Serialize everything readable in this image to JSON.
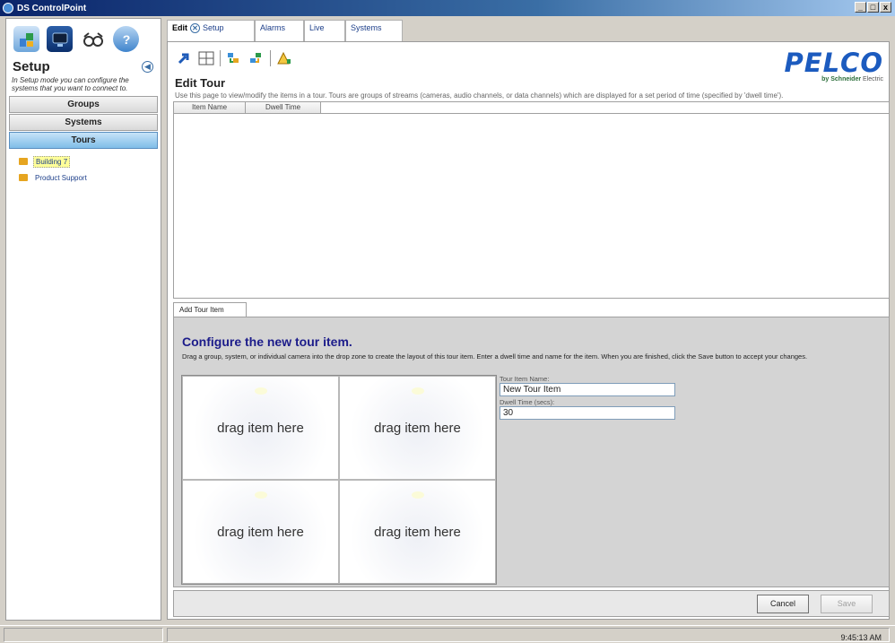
{
  "window": {
    "title": "DS ControlPoint",
    "min": "_",
    "max": "□",
    "close": "x"
  },
  "left": {
    "title": "Setup",
    "description": "In Setup mode you can configure the systems that you want to connect to.",
    "nav": [
      {
        "label": "Groups",
        "active": false
      },
      {
        "label": "Systems",
        "active": false
      },
      {
        "label": "Tours",
        "active": true
      }
    ],
    "tree": [
      {
        "label": "Building 7",
        "selected": true
      },
      {
        "label": "Product Support",
        "selected": false
      }
    ]
  },
  "tabs": {
    "edit": "Edit",
    "setup": "Setup",
    "alarms": "Alarms",
    "live": "Live",
    "systems": "Systems"
  },
  "logo": {
    "brand": "PELCO",
    "by": "by",
    "company": "Schneider",
    "company2": "Electric"
  },
  "page": {
    "title": "Edit Tour",
    "description": "Use this page to view/modify the items in a tour. Tours are groups of streams (cameras, audio channels, or data channels) which are displayed for a set period of time (specified by 'dwell time')."
  },
  "grid": {
    "columns": [
      "Item Name",
      "Dwell Time"
    ]
  },
  "subtab": "Add Tour Item",
  "config": {
    "title": "Configure the new tour item.",
    "description": "Drag a group, system, or individual camera into the drop zone to create the layout of this tour item. Enter a dwell time and name for the item. When you are finished, click the Save button to accept your changes.",
    "dropzones": [
      "drag item here",
      "drag item here",
      "drag item here",
      "drag item here"
    ],
    "name_label": "Tour Item Name:",
    "name_value": "New Tour Item",
    "dwell_label": "Dwell Time (secs):",
    "dwell_value": "30"
  },
  "buttons": {
    "cancel": "Cancel",
    "save": "Save"
  },
  "status": {
    "time": "9:45:13 AM"
  }
}
